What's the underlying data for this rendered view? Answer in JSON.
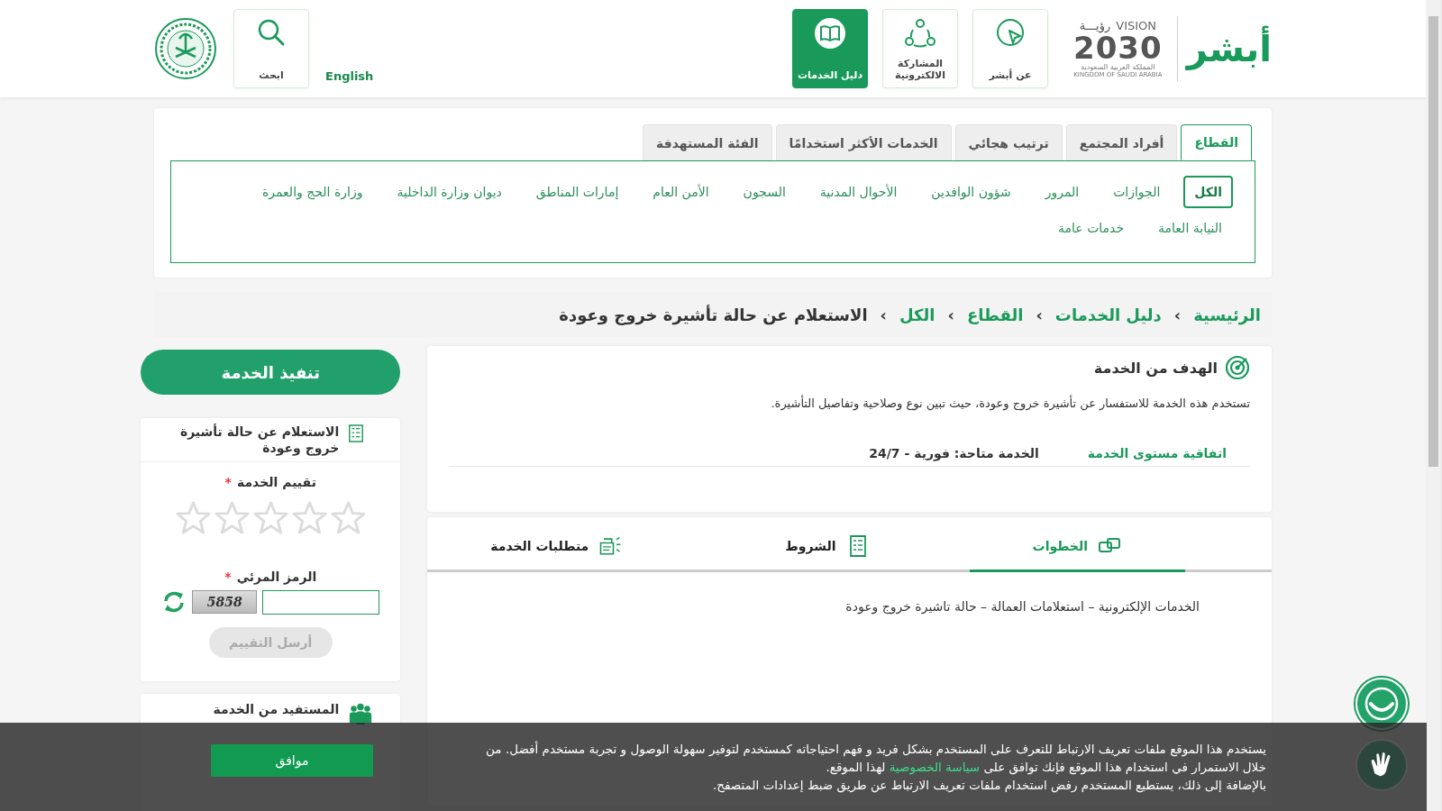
{
  "header": {
    "brand": "أبشر",
    "vision": {
      "word_ar": "رؤيـــة",
      "word_en": "VISION",
      "year": "2030",
      "country_ar": "المملكة العربية السعودية",
      "country_en": "KINGDOM OF SAUDI ARABIA"
    },
    "nav_items": [
      {
        "label": "عن أبشر",
        "kind": "pointer",
        "selected": false
      },
      {
        "label": "المشاركة الالكترونية",
        "kind": "network",
        "selected": false
      },
      {
        "label": "دليل الخدمات",
        "kind": "book",
        "selected": true
      }
    ],
    "language": "English",
    "search": "ابحث"
  },
  "category_tabs": [
    {
      "label": "القطاع",
      "selected": true
    },
    {
      "label": "أفراد المجتمع",
      "selected": false
    },
    {
      "label": "ترتيب هجائي",
      "selected": false
    },
    {
      "label": "الخدمات الأكثر استخدامًا",
      "selected": false
    },
    {
      "label": "الفئة المستهدفة",
      "selected": false
    }
  ],
  "sectors": [
    {
      "label": "الكل",
      "selected": true
    },
    {
      "label": "الجوازات",
      "selected": false
    },
    {
      "label": "المرور",
      "selected": false
    },
    {
      "label": "شؤون الوافدين",
      "selected": false
    },
    {
      "label": "الأحوال المدنية",
      "selected": false
    },
    {
      "label": "السجون",
      "selected": false
    },
    {
      "label": "الأمن العام",
      "selected": false
    },
    {
      "label": "إمارات المناطق",
      "selected": false
    },
    {
      "label": "ديوان وزارة الداخلية",
      "selected": false
    },
    {
      "label": "وزارة الحج والعمرة",
      "selected": false
    },
    {
      "label": "النيابة العامة",
      "selected": false
    },
    {
      "label": "خدمات عامة",
      "selected": false
    }
  ],
  "breadcrumb": {
    "separator": "›",
    "links": [
      "الرئيسية",
      "دليل الخدمات",
      "القطاع",
      "الكل"
    ],
    "current": "الاستعلام عن حالة تأشيرة خروج وعودة"
  },
  "goal": {
    "title": "الهدف من الخدمة",
    "description": "تستخدم هذه الخدمة للاستفسار عن تأشيرة خروج وعودة، حيث تبين نوع وصلاحية وتفاصيل التأشيرة.",
    "sla_link": "اتفاقية مستوى الخدمة",
    "availability": "الخدمة متاحة: فورية - 24/7"
  },
  "detail_tabs": [
    {
      "label": "الخطوات",
      "kind": "steps",
      "selected": true
    },
    {
      "label": "الشروط",
      "kind": "terms",
      "selected": false
    },
    {
      "label": "متطلبات الخدمة",
      "kind": "requirements",
      "selected": false
    }
  ],
  "steps_text": "الخدمات الإلكترونية – استعلامات العمالة – حالة تاشيرة خروج وعودة",
  "execute_button": "تنفيذ الخدمة",
  "rating_card": {
    "title": "الاستعلام عن حالة تأشيرة خروج وعودة",
    "rating_label": "تقييم الخدمة",
    "required_mark": "*",
    "stars": 0,
    "captcha_label": "الرمز المرئي",
    "captcha_text": "5858",
    "submit": "أرسل التقييم",
    "submit_disabled": true
  },
  "beneficiary_title": "المستفيد من الخدمة",
  "cookie_banner": {
    "text_before": "يستخدم هذا الموقع ملفات تعريف الارتباط للتعرف على المستخدم بشكل فريد و فهم احتياجاته كمستخدم لتوفير سهولة الوصول و تجربة مستخدم أفضل. من خلال الاستمرار في استخدام هذا الموقع فإنك توافق على ",
    "link": "سياسة الخصوصية",
    "text_after": " لهذا الموقع.",
    "text_second": "بالإضافة إلى ذلك، يستطيع المستخدم رفض استخدام ملفات تعريف الارتباط عن طريق ضبط إعدادات المتصفح.",
    "accept": "موافق"
  }
}
